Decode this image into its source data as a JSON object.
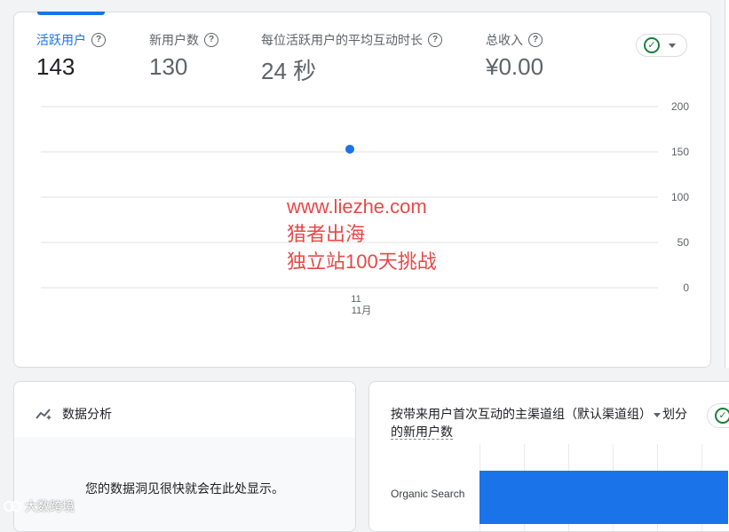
{
  "metrics": [
    {
      "label": "活跃用户",
      "value": "143",
      "active": true
    },
    {
      "label": "新用户数",
      "value": "130",
      "active": false
    },
    {
      "label": "每位活跃用户的平均互动时长",
      "value": "24 秒",
      "active": false
    },
    {
      "label": "总收入",
      "value": "¥0.00",
      "active": false
    }
  ],
  "help_glyph": "?",
  "check_glyph": "✓",
  "chart_data": {
    "type": "scatter",
    "series": [
      {
        "x": [
          "11"
        ],
        "values": [
          153
        ]
      }
    ],
    "ylim": [
      0,
      200
    ],
    "yticks": [
      "200",
      "150",
      "100",
      "50",
      "0"
    ],
    "xticks": [
      {
        "day": "11",
        "month": "11月"
      }
    ],
    "grid": true,
    "color": "#1a73e8"
  },
  "watermark": {
    "line1": "www.liezhe.com",
    "line2": "猎者出海",
    "line3": "独立站100天挑战"
  },
  "insights": {
    "title": "数据分析",
    "message": "您的数据洞见很快就会在此处显示。"
  },
  "channel": {
    "title_part1": "按带来用户首次互动的主渠道组（默认渠道组）",
    "title_part2": "划分",
    "title_part3": "的新用户数",
    "rows": [
      {
        "label": "Organic Search",
        "fraction": 1.0
      }
    ]
  },
  "corner_logo": "大数跨境",
  "colors": {
    "accent": "#1a73e8",
    "check": "#188038",
    "watermark": "#e84848"
  }
}
